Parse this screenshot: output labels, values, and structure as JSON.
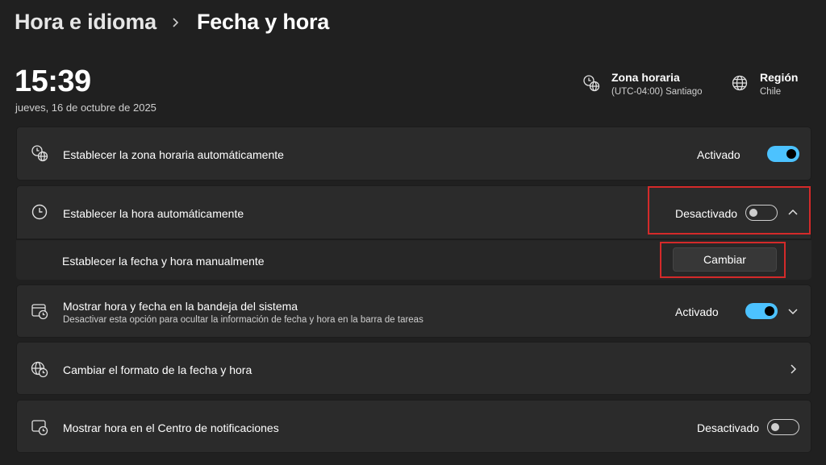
{
  "breadcrumb": {
    "parent": "Hora e idioma",
    "current": "Fecha y hora"
  },
  "clock": {
    "time": "15:39",
    "date": "jueves, 16 de octubre de 2025"
  },
  "timezone": {
    "title": "Zona horaria",
    "value": "(UTC-04:00) Santiago",
    "icon": "clock-globe-icon"
  },
  "region": {
    "title": "Región",
    "value": "Chile",
    "icon": "globe-icon"
  },
  "settings": {
    "auto_timezone": {
      "label": "Establecer la zona horaria automáticamente",
      "state": "Activado",
      "on": true
    },
    "auto_time": {
      "label": "Establecer la hora automáticamente",
      "state": "Desactivado",
      "on": false,
      "expanded": true
    },
    "manual": {
      "label": "Establecer la fecha y hora manualmente",
      "button": "Cambiar"
    },
    "tray": {
      "label": "Mostrar hora y fecha en la bandeja del sistema",
      "description": "Desactivar esta opción para ocultar la información de fecha y hora en la barra de tareas",
      "state": "Activado",
      "on": true
    },
    "format": {
      "label": "Cambiar el formato de la fecha y hora"
    },
    "notification_center": {
      "label": "Mostrar hora en el Centro de notificaciones",
      "state": "Desactivado",
      "on": false
    }
  },
  "colors": {
    "accent": "#4cc2ff",
    "highlight": "#d42a2a",
    "background": "#202020",
    "card": "#2b2b2b"
  }
}
